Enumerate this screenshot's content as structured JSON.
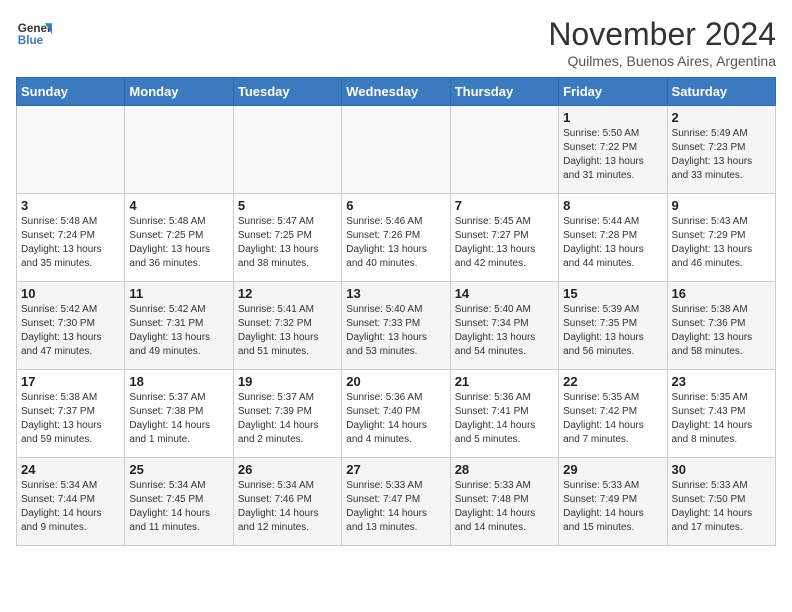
{
  "logo": {
    "line1": "General",
    "line2": "Blue"
  },
  "title": "November 2024",
  "location": "Quilmes, Buenos Aires, Argentina",
  "days_of_week": [
    "Sunday",
    "Monday",
    "Tuesday",
    "Wednesday",
    "Thursday",
    "Friday",
    "Saturday"
  ],
  "weeks": [
    [
      {
        "day": "",
        "sunrise": "",
        "sunset": "",
        "daylight": ""
      },
      {
        "day": "",
        "sunrise": "",
        "sunset": "",
        "daylight": ""
      },
      {
        "day": "",
        "sunrise": "",
        "sunset": "",
        "daylight": ""
      },
      {
        "day": "",
        "sunrise": "",
        "sunset": "",
        "daylight": ""
      },
      {
        "day": "",
        "sunrise": "",
        "sunset": "",
        "daylight": ""
      },
      {
        "day": "1",
        "sunrise": "Sunrise: 5:50 AM",
        "sunset": "Sunset: 7:22 PM",
        "daylight": "Daylight: 13 hours and 31 minutes."
      },
      {
        "day": "2",
        "sunrise": "Sunrise: 5:49 AM",
        "sunset": "Sunset: 7:23 PM",
        "daylight": "Daylight: 13 hours and 33 minutes."
      }
    ],
    [
      {
        "day": "3",
        "sunrise": "Sunrise: 5:48 AM",
        "sunset": "Sunset: 7:24 PM",
        "daylight": "Daylight: 13 hours and 35 minutes."
      },
      {
        "day": "4",
        "sunrise": "Sunrise: 5:48 AM",
        "sunset": "Sunset: 7:25 PM",
        "daylight": "Daylight: 13 hours and 36 minutes."
      },
      {
        "day": "5",
        "sunrise": "Sunrise: 5:47 AM",
        "sunset": "Sunset: 7:25 PM",
        "daylight": "Daylight: 13 hours and 38 minutes."
      },
      {
        "day": "6",
        "sunrise": "Sunrise: 5:46 AM",
        "sunset": "Sunset: 7:26 PM",
        "daylight": "Daylight: 13 hours and 40 minutes."
      },
      {
        "day": "7",
        "sunrise": "Sunrise: 5:45 AM",
        "sunset": "Sunset: 7:27 PM",
        "daylight": "Daylight: 13 hours and 42 minutes."
      },
      {
        "day": "8",
        "sunrise": "Sunrise: 5:44 AM",
        "sunset": "Sunset: 7:28 PM",
        "daylight": "Daylight: 13 hours and 44 minutes."
      },
      {
        "day": "9",
        "sunrise": "Sunrise: 5:43 AM",
        "sunset": "Sunset: 7:29 PM",
        "daylight": "Daylight: 13 hours and 46 minutes."
      }
    ],
    [
      {
        "day": "10",
        "sunrise": "Sunrise: 5:42 AM",
        "sunset": "Sunset: 7:30 PM",
        "daylight": "Daylight: 13 hours and 47 minutes."
      },
      {
        "day": "11",
        "sunrise": "Sunrise: 5:42 AM",
        "sunset": "Sunset: 7:31 PM",
        "daylight": "Daylight: 13 hours and 49 minutes."
      },
      {
        "day": "12",
        "sunrise": "Sunrise: 5:41 AM",
        "sunset": "Sunset: 7:32 PM",
        "daylight": "Daylight: 13 hours and 51 minutes."
      },
      {
        "day": "13",
        "sunrise": "Sunrise: 5:40 AM",
        "sunset": "Sunset: 7:33 PM",
        "daylight": "Daylight: 13 hours and 53 minutes."
      },
      {
        "day": "14",
        "sunrise": "Sunrise: 5:40 AM",
        "sunset": "Sunset: 7:34 PM",
        "daylight": "Daylight: 13 hours and 54 minutes."
      },
      {
        "day": "15",
        "sunrise": "Sunrise: 5:39 AM",
        "sunset": "Sunset: 7:35 PM",
        "daylight": "Daylight: 13 hours and 56 minutes."
      },
      {
        "day": "16",
        "sunrise": "Sunrise: 5:38 AM",
        "sunset": "Sunset: 7:36 PM",
        "daylight": "Daylight: 13 hours and 58 minutes."
      }
    ],
    [
      {
        "day": "17",
        "sunrise": "Sunrise: 5:38 AM",
        "sunset": "Sunset: 7:37 PM",
        "daylight": "Daylight: 13 hours and 59 minutes."
      },
      {
        "day": "18",
        "sunrise": "Sunrise: 5:37 AM",
        "sunset": "Sunset: 7:38 PM",
        "daylight": "Daylight: 14 hours and 1 minute."
      },
      {
        "day": "19",
        "sunrise": "Sunrise: 5:37 AM",
        "sunset": "Sunset: 7:39 PM",
        "daylight": "Daylight: 14 hours and 2 minutes."
      },
      {
        "day": "20",
        "sunrise": "Sunrise: 5:36 AM",
        "sunset": "Sunset: 7:40 PM",
        "daylight": "Daylight: 14 hours and 4 minutes."
      },
      {
        "day": "21",
        "sunrise": "Sunrise: 5:36 AM",
        "sunset": "Sunset: 7:41 PM",
        "daylight": "Daylight: 14 hours and 5 minutes."
      },
      {
        "day": "22",
        "sunrise": "Sunrise: 5:35 AM",
        "sunset": "Sunset: 7:42 PM",
        "daylight": "Daylight: 14 hours and 7 minutes."
      },
      {
        "day": "23",
        "sunrise": "Sunrise: 5:35 AM",
        "sunset": "Sunset: 7:43 PM",
        "daylight": "Daylight: 14 hours and 8 minutes."
      }
    ],
    [
      {
        "day": "24",
        "sunrise": "Sunrise: 5:34 AM",
        "sunset": "Sunset: 7:44 PM",
        "daylight": "Daylight: 14 hours and 9 minutes."
      },
      {
        "day": "25",
        "sunrise": "Sunrise: 5:34 AM",
        "sunset": "Sunset: 7:45 PM",
        "daylight": "Daylight: 14 hours and 11 minutes."
      },
      {
        "day": "26",
        "sunrise": "Sunrise: 5:34 AM",
        "sunset": "Sunset: 7:46 PM",
        "daylight": "Daylight: 14 hours and 12 minutes."
      },
      {
        "day": "27",
        "sunrise": "Sunrise: 5:33 AM",
        "sunset": "Sunset: 7:47 PM",
        "daylight": "Daylight: 14 hours and 13 minutes."
      },
      {
        "day": "28",
        "sunrise": "Sunrise: 5:33 AM",
        "sunset": "Sunset: 7:48 PM",
        "daylight": "Daylight: 14 hours and 14 minutes."
      },
      {
        "day": "29",
        "sunrise": "Sunrise: 5:33 AM",
        "sunset": "Sunset: 7:49 PM",
        "daylight": "Daylight: 14 hours and 15 minutes."
      },
      {
        "day": "30",
        "sunrise": "Sunrise: 5:33 AM",
        "sunset": "Sunset: 7:50 PM",
        "daylight": "Daylight: 14 hours and 17 minutes."
      }
    ]
  ]
}
